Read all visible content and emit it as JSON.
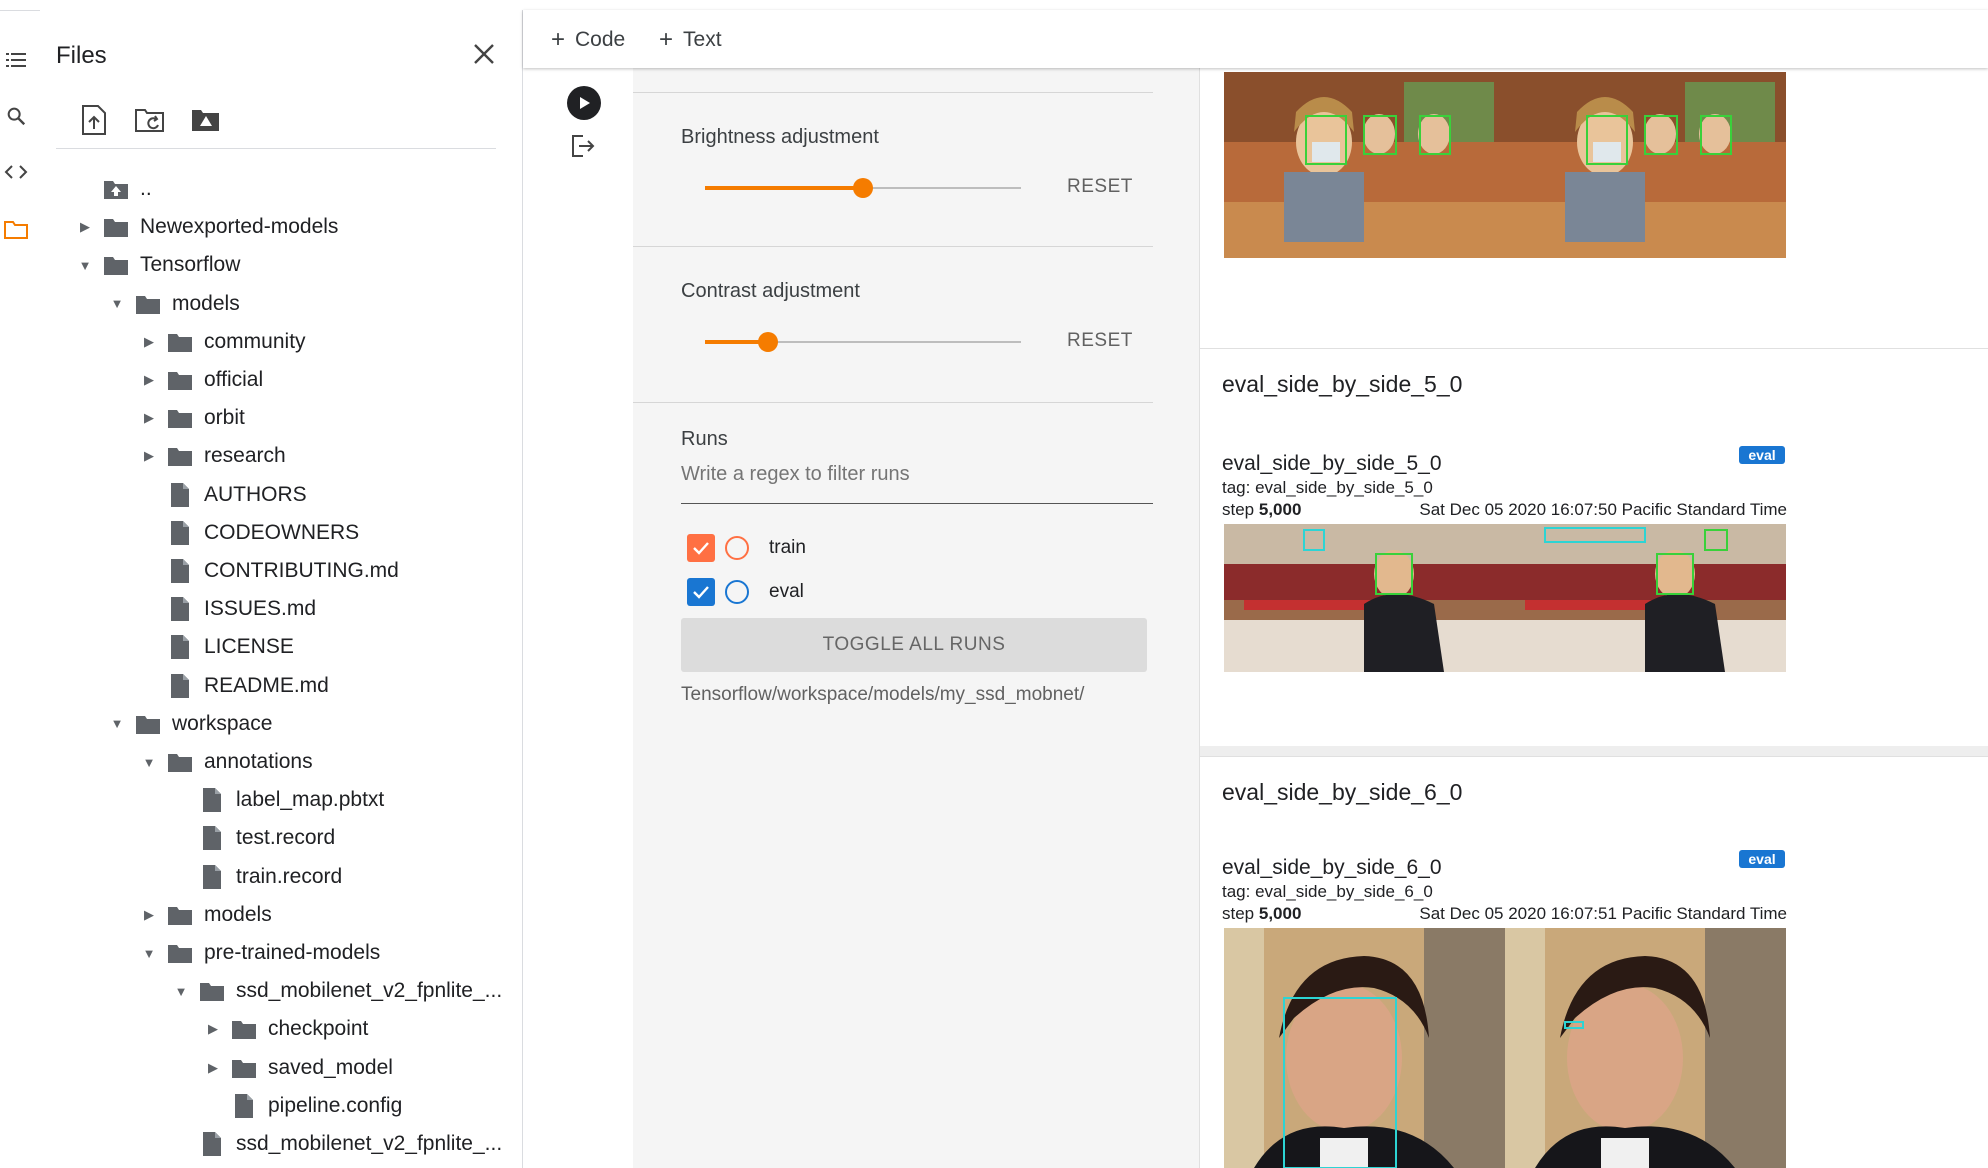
{
  "files_panel": {
    "title": "Files",
    "tree": [
      {
        "label": "..",
        "type": "parent",
        "expand": "none",
        "depth": 0
      },
      {
        "label": "Newexported-models",
        "type": "folder",
        "expand": "collapsed",
        "depth": 0
      },
      {
        "label": "Tensorflow",
        "type": "folder",
        "expand": "expanded",
        "depth": 0
      },
      {
        "label": "models",
        "type": "folder",
        "expand": "expanded",
        "depth": 1
      },
      {
        "label": "community",
        "type": "folder",
        "expand": "collapsed",
        "depth": 2
      },
      {
        "label": "official",
        "type": "folder",
        "expand": "collapsed",
        "depth": 2
      },
      {
        "label": "orbit",
        "type": "folder",
        "expand": "collapsed",
        "depth": 2
      },
      {
        "label": "research",
        "type": "folder",
        "expand": "collapsed",
        "depth": 2
      },
      {
        "label": "AUTHORS",
        "type": "file",
        "expand": "none",
        "depth": 2
      },
      {
        "label": "CODEOWNERS",
        "type": "file",
        "expand": "none",
        "depth": 2
      },
      {
        "label": "CONTRIBUTING.md",
        "type": "file",
        "expand": "none",
        "depth": 2
      },
      {
        "label": "ISSUES.md",
        "type": "file",
        "expand": "none",
        "depth": 2
      },
      {
        "label": "LICENSE",
        "type": "file",
        "expand": "none",
        "depth": 2
      },
      {
        "label": "README.md",
        "type": "file",
        "expand": "none",
        "depth": 2
      },
      {
        "label": "workspace",
        "type": "folder",
        "expand": "expanded",
        "depth": 1
      },
      {
        "label": "annotations",
        "type": "folder",
        "expand": "expanded",
        "depth": 2
      },
      {
        "label": "label_map.pbtxt",
        "type": "file",
        "expand": "none",
        "depth": 3
      },
      {
        "label": "test.record",
        "type": "file",
        "expand": "none",
        "depth": 3
      },
      {
        "label": "train.record",
        "type": "file",
        "expand": "none",
        "depth": 3
      },
      {
        "label": "models",
        "type": "folder",
        "expand": "collapsed",
        "depth": 2
      },
      {
        "label": "pre-trained-models",
        "type": "folder",
        "expand": "expanded",
        "depth": 2
      },
      {
        "label": "ssd_mobilenet_v2_fpnlite_...",
        "type": "folder",
        "expand": "expanded",
        "depth": 3
      },
      {
        "label": "checkpoint",
        "type": "folder",
        "expand": "collapsed",
        "depth": 4
      },
      {
        "label": "saved_model",
        "type": "folder",
        "expand": "collapsed",
        "depth": 4
      },
      {
        "label": "pipeline.config",
        "type": "file",
        "expand": "none",
        "depth": 4
      },
      {
        "label": "ssd_mobilenet_v2_fpnlite_...",
        "type": "file",
        "expand": "none",
        "depth": 3
      }
    ]
  },
  "toolbar": {
    "code_label": "Code",
    "text_label": "Text"
  },
  "tensorboard_sidebar": {
    "brightness_label": "Brightness adjustment",
    "brightness_value": 0.5,
    "contrast_label": "Contrast adjustment",
    "contrast_value": 0.2,
    "reset_label": "RESET",
    "runs_label": "Runs",
    "filter_placeholder": "Write a regex to filter runs",
    "runs": [
      {
        "name": "train",
        "checked": true,
        "color": "#ff7043"
      },
      {
        "name": "eval",
        "checked": true,
        "color": "#1976d2"
      }
    ],
    "toggle_all_label": "TOGGLE ALL RUNS",
    "log_dir": "Tensorflow/workspace/models/my_ssd_mobnet/"
  },
  "cards": [
    {
      "header": "eval_side_by_side_5_0",
      "panel_title": "eval_side_by_side_5_0",
      "tag": "tag: eval_side_by_side_5_0",
      "step_label": "step",
      "step_value": "5,000",
      "timestamp": "Sat Dec 05 2020 16:07:50 Pacific Standard Time",
      "run_badge": "eval"
    },
    {
      "header": "eval_side_by_side_6_0",
      "panel_title": "eval_side_by_side_6_0",
      "tag": "tag: eval_side_by_side_6_0",
      "step_label": "step",
      "step_value": "5,000",
      "timestamp": "Sat Dec 05 2020 16:07:51 Pacific Standard Time",
      "run_badge": "eval"
    }
  ],
  "colors": {
    "accent_orange": "#f57c00",
    "train_color": "#ff7043",
    "eval_color": "#1976d2"
  }
}
